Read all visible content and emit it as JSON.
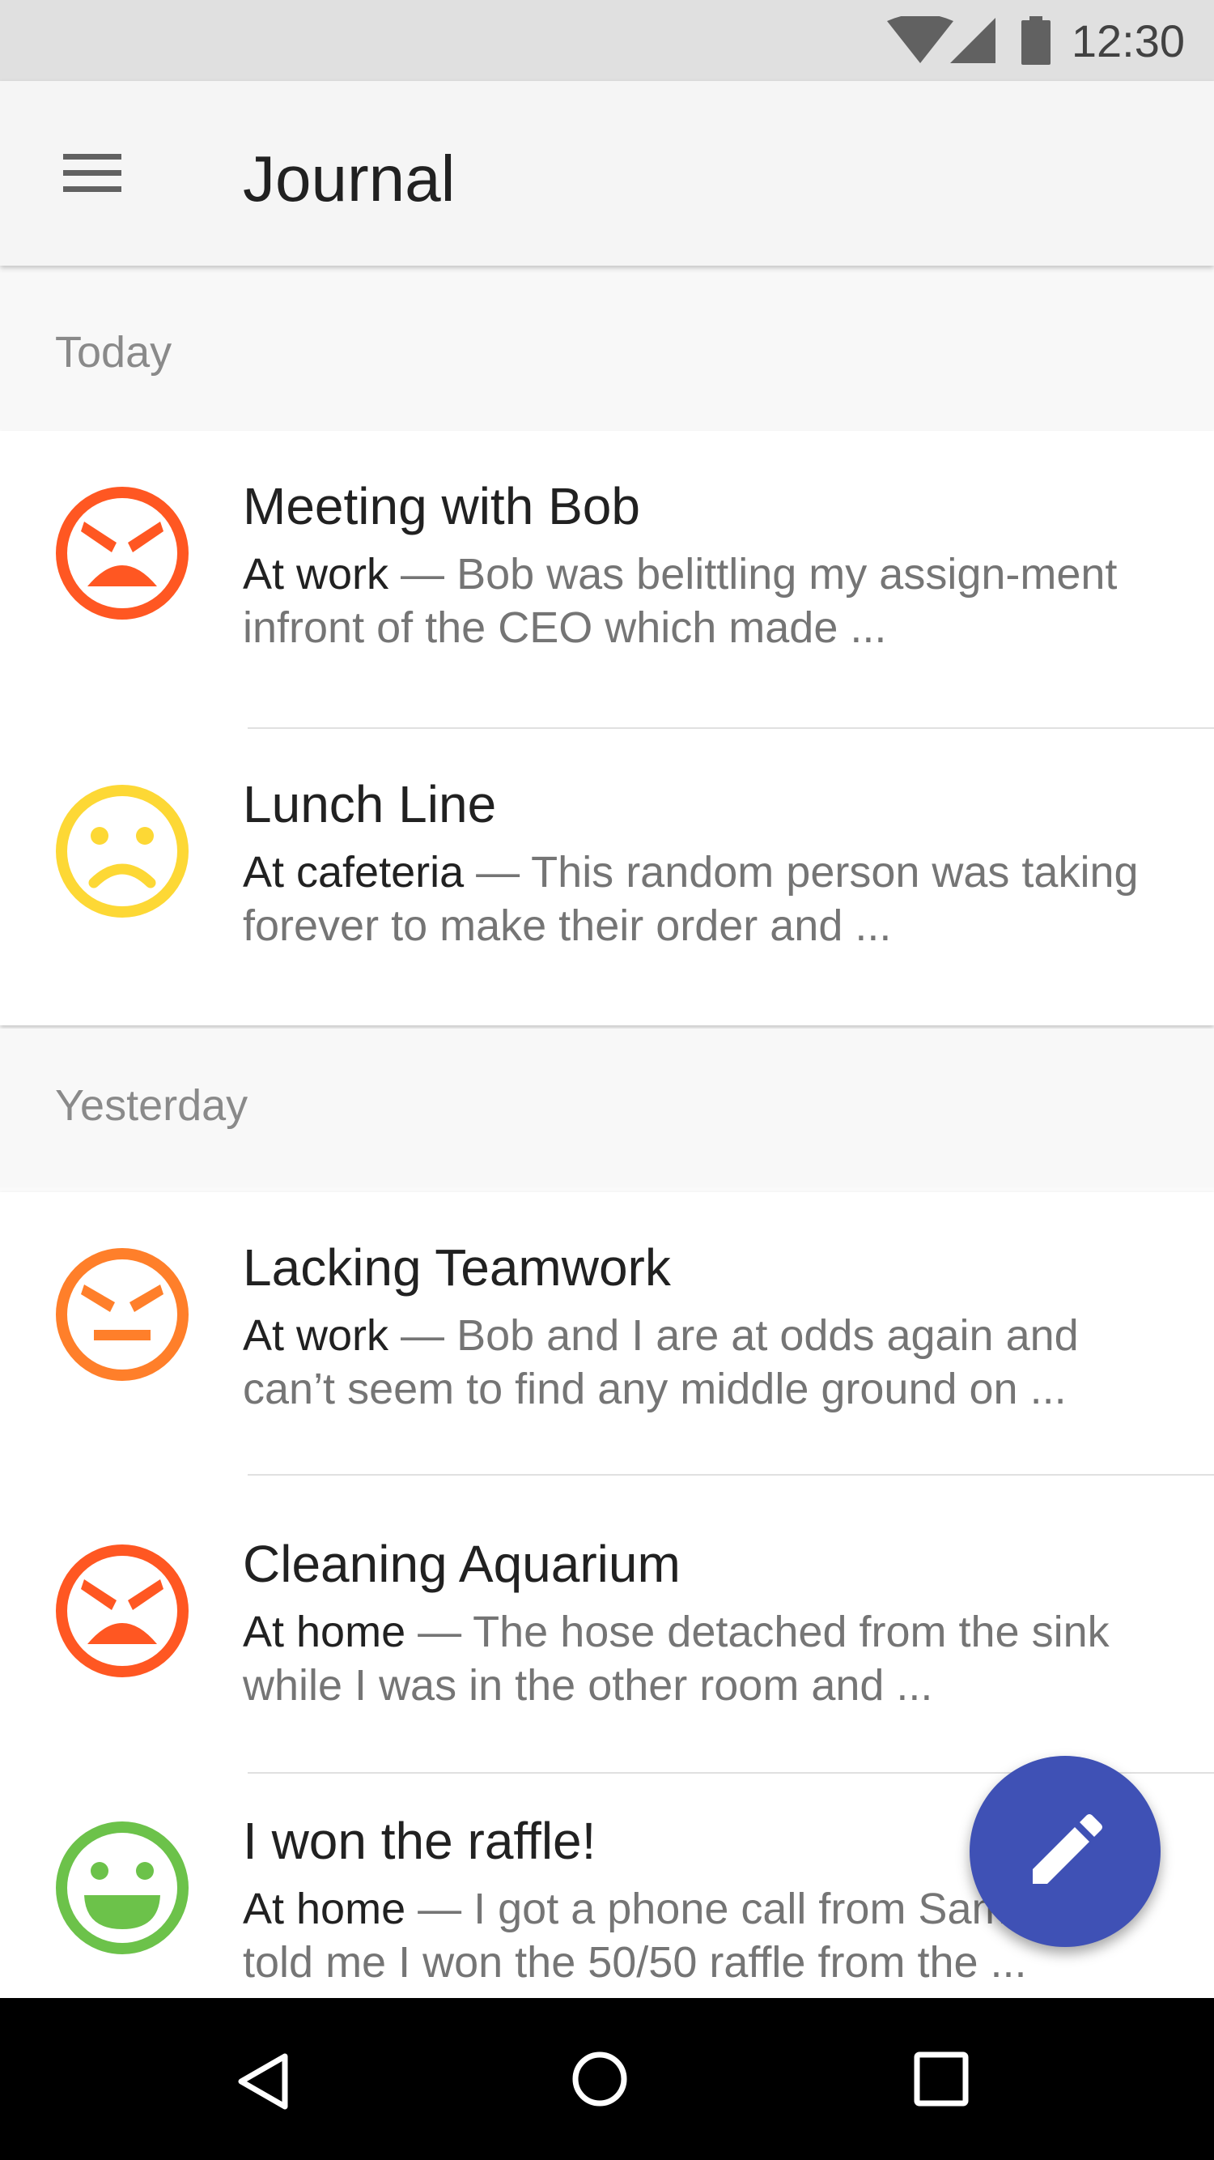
{
  "status_bar": {
    "time": "12:30",
    "icons": [
      "wifi-icon",
      "cell-signal-icon",
      "battery-icon"
    ]
  },
  "app_bar": {
    "title": "Journal",
    "menu_icon": "menu-icon"
  },
  "colors": {
    "angry": "#ff5722",
    "annoyed": "#ff7f2a",
    "sad": "#fdd835",
    "happy": "#6cc24a",
    "fab": "#3f51b5"
  },
  "sections": [
    {
      "label": "Today",
      "entries": [
        {
          "mood_icon": "angry-face-icon",
          "title": "Meeting with Bob",
          "place": "At work",
          "separator": " — ",
          "text": "Bob was belittling my assign-ment infront of the CEO which made ..."
        },
        {
          "mood_icon": "sad-face-icon",
          "title": "Lunch Line",
          "place": "At cafeteria",
          "separator": " — ",
          "text": "This random person was taking forever to make their order and ..."
        }
      ]
    },
    {
      "label": "Yesterday",
      "entries": [
        {
          "mood_icon": "annoyed-face-icon",
          "title": "Lacking Teamwork",
          "place": "At work",
          "separator": " — ",
          "text": "Bob and I are at odds again and can’t seem to find any middle ground on ..."
        },
        {
          "mood_icon": "angry-face-icon",
          "title": "Cleaning Aquarium",
          "place": "At home",
          "separator": " — ",
          "text": "The hose detached from the sink while I was in the other room and ..."
        },
        {
          "mood_icon": "happy-face-icon",
          "title": "I won the raffle!",
          "place": "At home",
          "separator": " — ",
          "text": "I got a phone call from Sam who told me I won the 50/50 raffle from the ..."
        }
      ]
    }
  ],
  "fab": {
    "icon": "pencil-icon"
  },
  "nav_bar": {
    "icons": [
      "back-icon",
      "home-icon",
      "recents-icon"
    ]
  }
}
